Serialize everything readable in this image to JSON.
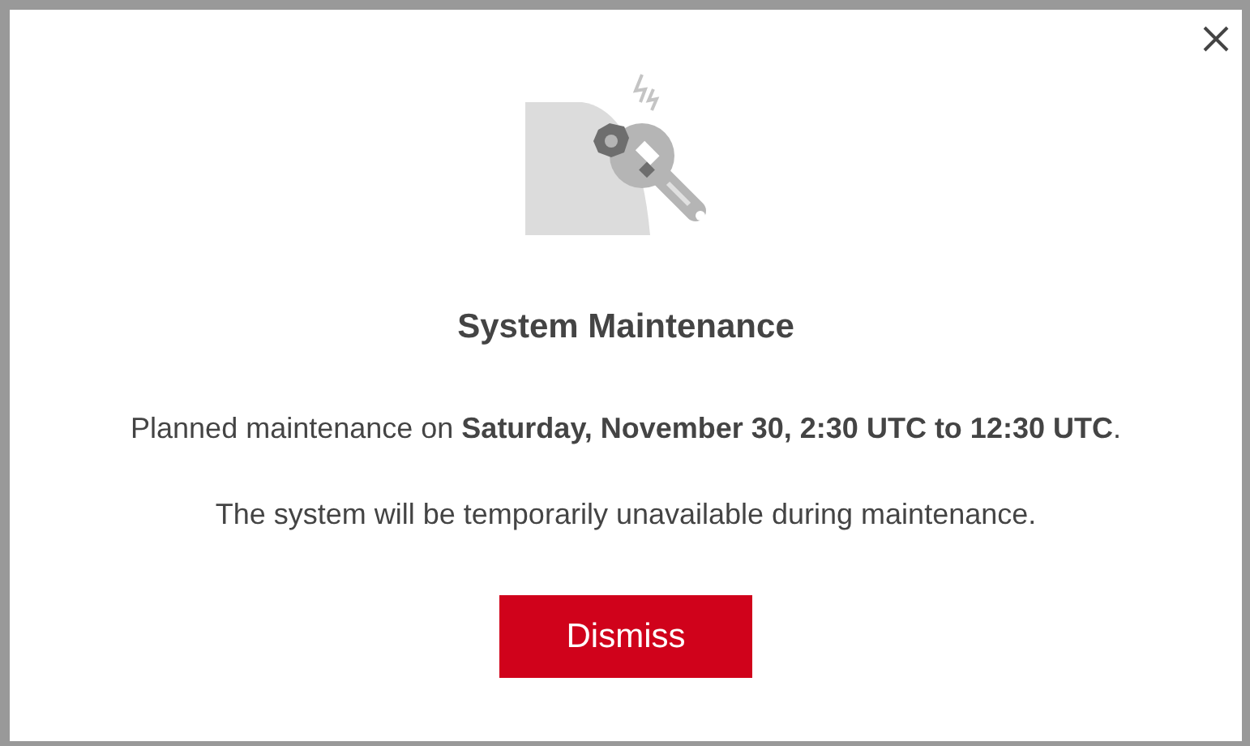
{
  "dialog": {
    "title": "System Maintenance",
    "message": "Planned maintenance on **Saturday, November 30, 2:30 UTC to 12:30 UTC**.",
    "note": "The system will be temporarily unavailable during maintenance.",
    "buttons": [
      {
        "label": "Dismiss",
        "kind": "primary"
      }
    ]
  }
}
